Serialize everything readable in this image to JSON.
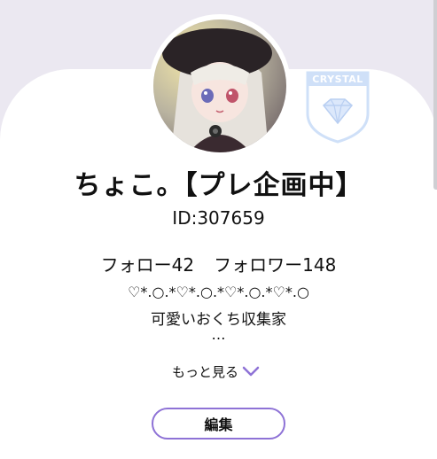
{
  "profile": {
    "display_name": "ちょこ。【プレ企画中】",
    "user_id": "ID:307659",
    "following_label": "フォロー42",
    "followers_label": "フォロワー148",
    "bio_line1": "♡*.○.*♡*.○.*♡*.○.*♡*.○",
    "bio_line2": "可愛いおくち収集家",
    "bio_line3": "…"
  },
  "badge": {
    "label": "CRYSTAL",
    "icon": "diamond-icon"
  },
  "actions": {
    "show_more_label": "もっと見る",
    "show_more_icon": "chevron-down-icon",
    "edit_label": "編集"
  },
  "colors": {
    "accent": "#8e72d6",
    "badge": "#cfe0f8",
    "background": "#ebe8f1"
  }
}
